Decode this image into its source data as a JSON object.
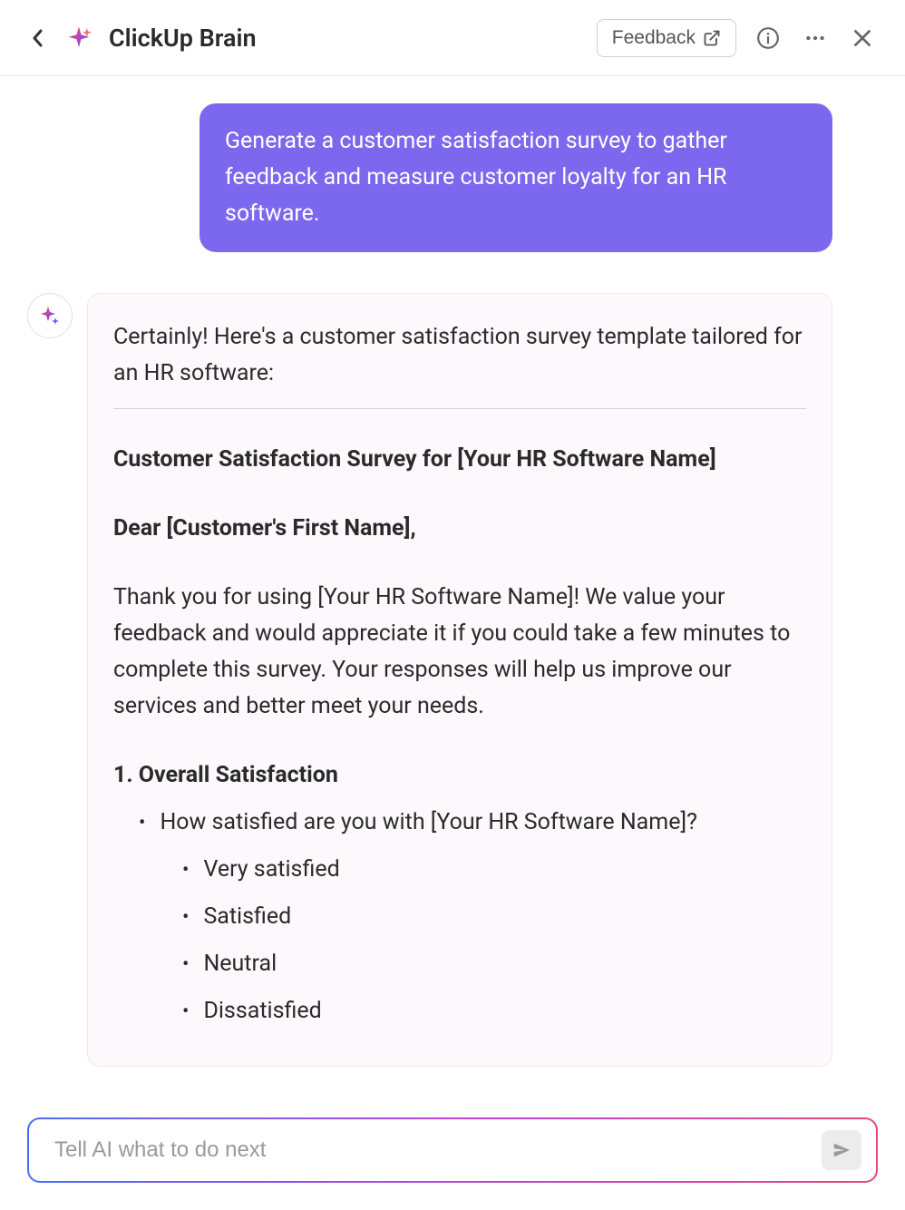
{
  "header": {
    "title": "ClickUp Brain",
    "feedback_label": "Feedback"
  },
  "chat": {
    "user_message": "Generate a customer satisfaction survey to gather feedback and measure customer loyalty for an HR software.",
    "assistant": {
      "intro": "Certainly! Here's a customer satisfaction survey template tailored for an HR software:",
      "survey_title": "Customer Satisfaction Survey for [Your HR Software Name]",
      "greeting": "Dear [Customer's First Name],",
      "thank_you": "Thank you for using [Your HR Software Name]! We value your feedback and would appreciate it if you could take a few minutes to complete this survey. Your responses will help us improve our services and better meet your needs.",
      "section1": {
        "heading": "1. Overall Satisfaction",
        "question": "How satisfied are you with [Your HR Software Name]?",
        "options": [
          "Very satisfied",
          "Satisfied",
          "Neutral",
          "Dissatisfied"
        ]
      }
    }
  },
  "input": {
    "placeholder": "Tell AI what to do next"
  }
}
